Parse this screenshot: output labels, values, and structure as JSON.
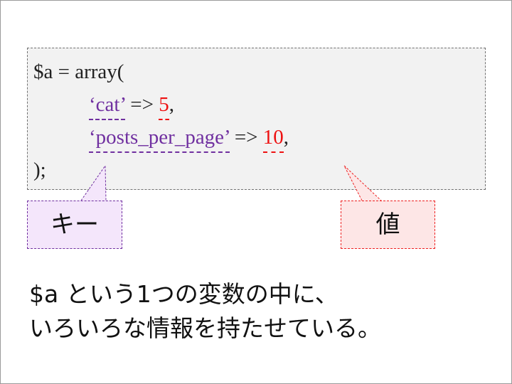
{
  "code": {
    "line1": "$a = array(",
    "line2_key": "‘cat’",
    "line2_arrow": " => ",
    "line2_value": "5",
    "line2_comma": ",",
    "line3_key": "‘posts_per_page’",
    "line3_arrow": " => ",
    "line3_value": "10",
    "line3_comma": ",",
    "line4": ");"
  },
  "callouts": {
    "key_label": "キー",
    "value_label": "値"
  },
  "caption": {
    "line1": "$a という1つの変数の中に、",
    "line2": "いろいろな情報を持たせている。"
  },
  "colors": {
    "key": "#7030a0",
    "value": "#ee1111",
    "code_bg": "#f2f2f2",
    "key_callout_bg": "#f4e6fb",
    "value_callout_bg": "#fde6e6"
  }
}
